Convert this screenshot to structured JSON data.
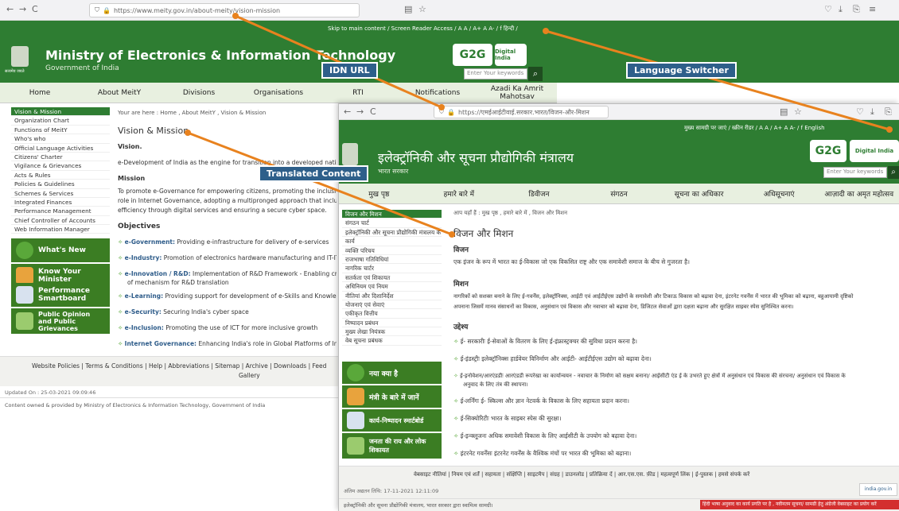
{
  "back_browser": {
    "url": "https://www.meity.gov.in/about-meity/vision-mission"
  },
  "front_browser": {
    "url": "https://एमईआईटीवाई.सरकार.भारत/विजन-और-मिशन"
  },
  "en": {
    "top_strip": "Skip to main content / Screen Reader Access / A A / A+ A A- / f  हिन्दी /",
    "title": "Ministry of Electronics & Information Technology",
    "subtitle": "Government of India",
    "emblem_text": "सत्यमेव जयते",
    "search_placeholder": "Enter Your keywords",
    "nav": [
      "Home",
      "About MeitY",
      "Divisions",
      "Organisations",
      "RTI",
      "Notifications",
      "Azadi Ka Amrit Mahotsav"
    ],
    "sidebar": [
      "Vision & Mission",
      "Organization Chart",
      "Functions of MeitY",
      "Who's who",
      "Official Language Activities",
      "Citizens' Charter",
      "Vigilance & Grievances",
      "Acts & Rules",
      "Policies & Guidelines",
      "Schemes & Services",
      "Integrated Finances",
      "Performance Management",
      "Chief Controller of Accounts",
      "Web Information Manager"
    ],
    "tiles": [
      "What's New",
      "Know Your Minister",
      "Performance Smartboard",
      "Public Opinion and Public Grievances"
    ],
    "breadcrumb": "Your are here : Home , About MeitY , Vision & Mission",
    "heading": "Vision & Mission",
    "vision_h": "Vision.",
    "vision_text": "e-Development of India as the engine for transition into a developed nation and an",
    "mission_h": "Mission",
    "mission_text": [
      "To promote e-Governance for empowering citizens, promoting the inclusive and s",
      "role in Internet Governance, adopting a multipronged approach that includes de",
      "efficiency through digital services and ensuring a secure cyber space."
    ],
    "objectives_h": "Objectives",
    "objectives": [
      {
        "k": "e-Government:",
        "v": " Providing e-infrastructure for delivery of e-services"
      },
      {
        "k": "e-Industry:",
        "v": " Promotion of electronics hardware manufacturing and IT-ITeS indu"
      },
      {
        "k": "e-Innovation / R&D:",
        "v": " Implementation of R&D Framework - Enabling creation c"
      },
      {
        "k": "",
        "v": "of mechanism for R&D translation"
      },
      {
        "k": "e-Learning:",
        "v": " Providing support for development of e-Skills and Knowledge netw"
      },
      {
        "k": "e-Security:",
        "v": " Securing India's cyber space"
      },
      {
        "k": "e-Inclusion:",
        "v": " Promoting the use of ICT for more inclusive growth"
      },
      {
        "k": "Internet Governance:",
        "v": " Enhancing India's role in Global Platforms of Internet Go"
      }
    ],
    "footer_links": "Website Policies  |  Terms & Conditions  |  Help  |  Abbreviations  |  Sitemap  |  Archive  |  Downloads  |  Feed",
    "footer_gallery": "Gallery",
    "updated": "Updated On : 25-03-2021 09:09:46",
    "content_owned": "Content owned & provided by Ministry of Electronics & Information Technology, Government of India"
  },
  "hi": {
    "top_strip": "मुख्य सामग्री पर जाएं / स्क्रीन रीडर / A A / A+ A A- / f  English",
    "title": "इलेक्ट्रॉनिकी और सूचना प्रौद्योगिकी मंत्रालय",
    "subtitle": "भारत सरकार",
    "search_placeholder": "Enter Your keywords",
    "nav": [
      "मुख पृष्ठ",
      "हमारे बारे में",
      "डिवीजन",
      "संगठन",
      "सूचना का अधिकार",
      "अधिसूचनाएं",
      "आज़ादी का अमृत महोत्सव"
    ],
    "sidebar": [
      "विजन और मिशन",
      "संगठन चार्ट",
      "इलेक्ट्रॉनिकी और सूचना प्रौद्योगिकी मंत्रालय के",
      "कार्य",
      "व्यक्ति परिचय",
      "राजभाषा गतिविधियां",
      "नागरिक चार्टर",
      "सतर्कता एवं शिकायत",
      "अधिनियम एवं नियम",
      "नीतियां और दिशानिर्देश",
      "योजनाएं एवं सेवाएं",
      "एकीकृत वित्तीय",
      "निष्पादन प्रबंधन",
      "मुख्य लेखा नियंत्रक",
      "वेब सूचना प्रबंधक"
    ],
    "tiles": [
      "नया क्या है",
      "मंत्री के बारे में जानें",
      "कार्य-निष्पादन स्मार्टबोर्ड",
      "जनता की राय और लोक शिकायत"
    ],
    "breadcrumb": "आप यहाँ हैं : मुख पृष्ठ , हमारे बारे में , विजन और मिशन",
    "heading": "विजन और मिशन",
    "vision_h": "विजन",
    "vision_text": "एक इंजन के रूप में भारत का ई-विकास जो एक विकसित राष्ट्र और एक समावेशी समाज के बीच से गुजरता है।",
    "mission_h": "मिशन",
    "mission_text": [
      "नागरिकों को सशक्त बनाने के लिए ई-गवर्नेंस, इलेक्ट्रॉनिक्स, आईटी एवं आईटीईएस उद्योगों के समावेशी और टिकाऊ विकास को बढ़ावा देना, इंटरनेट गवर्नेंस में भारत की भूमिका को बढ़ाना, बहुआयामी दृष्टिको",
      "अपनाना जिसमें मानव संसाधनों का विकास, अनुसंधान एवं विकास और नवाचार को बढ़ावा देना, डिजिटल सेवाओं द्वारा दक्षता बढ़ाना और सुरक्षित साइबर स्पेस सुनिश्चित करना।"
    ],
    "objectives_h": "उद्देश्य",
    "objectives": [
      "ई- सरकारीः ई-सेवाओं के वितरण के लिए ई-इंफ्रास्ट्रक्चर की सुविधा प्रदान करना है।",
      "ई-इंडस्ट्रीः इलेक्ट्रॉनिक्स हार्डवेयर विनिर्माण और आईटी- आईटीईएस उद्योग को बढ़ावा देना।",
      "ई-इनोवेशन/आरएंडडीः आरएंडडी रूपरेखा का कार्यान्वयन - नवाचार के निर्माण को सक्षम बनाना/ आईसीटी एंड ई के उभरते हुए क्षेत्रों में अनुसंधान एवं विकास की संरचना/ अनुसंधान एवं विकास के",
      "अनुवाद के लिए तंत्र की स्थापना।",
      "ई-लर्निंगः ई- स्किल्स और ज्ञान नेटवर्क के विकास के लिए सहायता प्रदान करना।",
      "ई-सिक्योरिटीः भारत के साइबर स्पेस की सुरक्षा।",
      "ई-इन्क्लूजनः अधिक समावेशी विकास के लिए आईसीटी के उपयोग को बढ़ावा देना।",
      "इंटरनेट गवर्नेंसः इंटरनेट गवर्नेंस के वैश्विक मंचों पर भारत की भूमिका को बढ़ाना।"
    ],
    "footer_links": "वेबसाइट नीतियां  |  नियम एवं शर्तें  |  सहायता  |  संक्षिप्ति  |  साइटमैप  |  संग्रह  |  डाउनलोड  |  प्रतिक्रिया दें  |  आर.एस.एस. फ़ीड  |  महत्वपूर्ण लिंक  |  ई-पुस्तक  |  हमसे संपर्क करें",
    "updated": "अंतिम अद्यतन तिथि: 17-11-2021 12:11:09",
    "content_owned": "इलेक्ट्रॉनिकी और सूचना प्रौद्योगिकी मंत्रालय, भारत सरकार द्वारा स्वामित्व सामग्री।",
    "red_notice": "हिंदी भाषा अनुवाद का कार्य प्रगति पर है , नवीनतम सूचना/ सामग्री हेतु अंग्रेजी वेबसाइट का प्रयोग करें"
  },
  "callouts": {
    "idn": "IDN URL",
    "lang": "Language Switcher",
    "translated": "Translated Content"
  },
  "colors": {
    "green": "#2e7d32",
    "callout": "#2e5f8a",
    "arrow": "#e8821e"
  }
}
